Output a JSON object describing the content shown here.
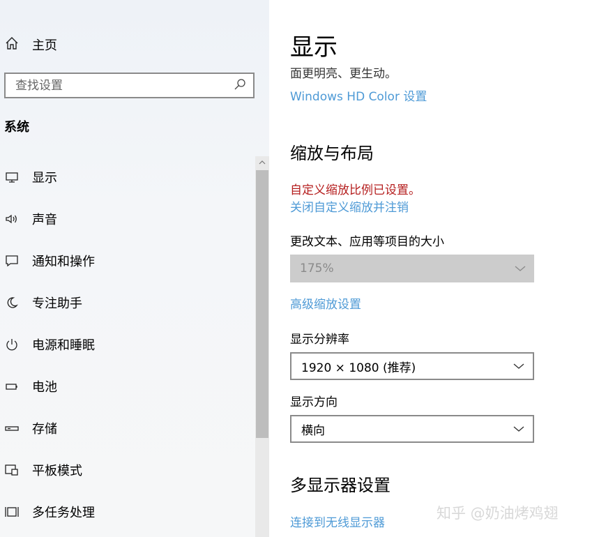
{
  "sidebar": {
    "home_label": "主页",
    "search_placeholder": "查找设置",
    "section_title": "系统",
    "items": [
      {
        "label": "显示",
        "icon": "monitor-icon"
      },
      {
        "label": "声音",
        "icon": "speaker-icon"
      },
      {
        "label": "通知和操作",
        "icon": "message-icon"
      },
      {
        "label": "专注助手",
        "icon": "moon-icon"
      },
      {
        "label": "电源和睡眠",
        "icon": "power-icon"
      },
      {
        "label": "电池",
        "icon": "battery-icon"
      },
      {
        "label": "存储",
        "icon": "storage-icon"
      },
      {
        "label": "平板模式",
        "icon": "tablet-icon"
      },
      {
        "label": "多任务处理",
        "icon": "multitask-icon"
      }
    ]
  },
  "main": {
    "title": "显示",
    "subtitle": "面更明亮、更生动。",
    "hdr_link": "Windows HD Color 设置",
    "scale_heading": "缩放与布局",
    "custom_scale_warning": "自定义缩放比例已设置。",
    "reset_link": "关闭自定义缩放并注销",
    "text_size_label": "更改文本、应用等项目的大小",
    "text_size_value": "175%",
    "advanced_scale_link": "高级缩放设置",
    "resolution_label": "显示分辨率",
    "resolution_value": "1920 × 1080 (推荐)",
    "orientation_label": "显示方向",
    "orientation_value": "横向",
    "multi_display_heading": "多显示器设置",
    "wireless_link": "连接到无线显示器"
  },
  "watermark": "知乎 @奶油烤鸡翅",
  "colors": {
    "link": "#4e9ad6",
    "warning": "#b51e1e",
    "disabled_bg": "#cccccc"
  }
}
